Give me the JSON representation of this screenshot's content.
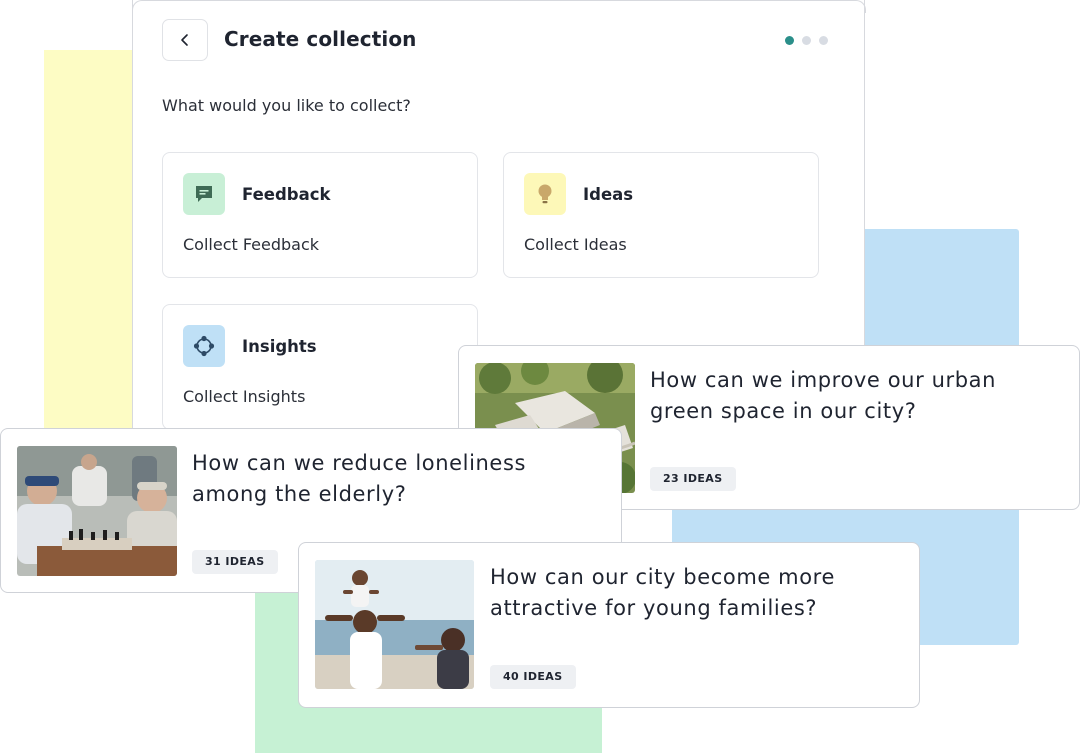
{
  "colors": {
    "accent": "#2b8f8a",
    "feedback_icon_bg": "#c8efd6",
    "ideas_icon_bg": "#fdf8b8",
    "insights_icon_bg": "#bfe0f6"
  },
  "panel": {
    "title": "Create collection",
    "back_icon": "chevron-left-icon",
    "question": "What would you like to collect?",
    "progress": {
      "current_step": 1,
      "total_steps": 3
    }
  },
  "options": [
    {
      "title": "Feedback",
      "description": "Collect Feedback",
      "icon": "message-square-icon"
    },
    {
      "title": "Ideas",
      "description": "Collect Ideas",
      "icon": "lightbulb-icon"
    },
    {
      "title": "Insights",
      "description": "Collect Insights",
      "icon": "hub-icon"
    }
  ],
  "cards": [
    {
      "title_line1": "How can we improve our urban",
      "title_line2": "green space in our city?",
      "badge": "23 IDEAS",
      "image": "aerial-city-photo"
    },
    {
      "title_line1": "How can we reduce loneliness",
      "title_line2": "among the elderly?",
      "badge": "31 IDEAS",
      "image": "elderly-chess-photo"
    },
    {
      "title_line1": "How can our city become more",
      "title_line2": "attractive for young families?",
      "badge": "40 IDEAS",
      "image": "family-beach-photo"
    }
  ]
}
